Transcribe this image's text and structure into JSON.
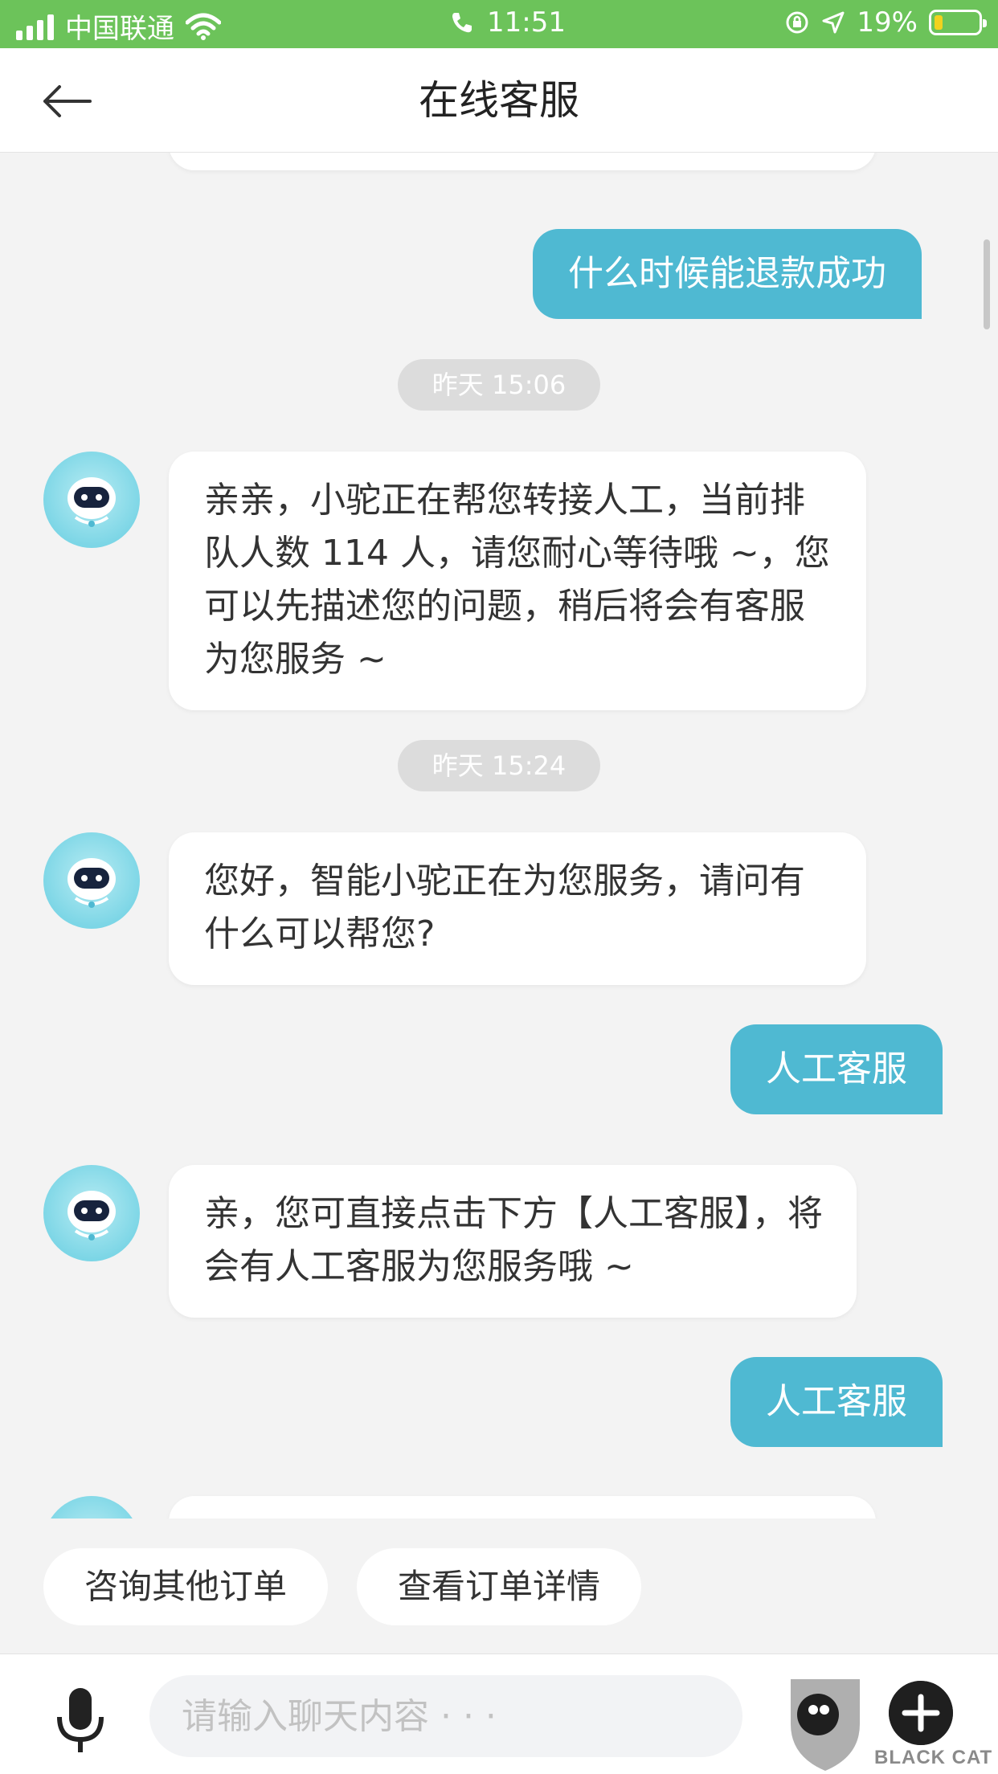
{
  "status_bar": {
    "carrier": "中国联通",
    "time": "11:51",
    "battery": "19%"
  },
  "header": {
    "title": "在线客服"
  },
  "chat": {
    "msg_user_1": "什么时候能退款成功",
    "time_1": "昨天 15:06",
    "msg_bot_1": "亲亲，小驼正在帮您转接人工，当前排队人数 114 人，请您耐心等待哦 ~，您可以先描述您的问题，稍后将会有客服为您服务 ~",
    "time_2": "昨天 15:24",
    "msg_bot_2": "您好，智能小驼正在为您服务，请问有什么可以帮您?",
    "msg_user_2": "人工客服",
    "msg_bot_3": "亲，您可直接点击下方【人工客服】，将会有人工客服为您服务哦 ~",
    "msg_user_3": "人工客服"
  },
  "quick_actions": {
    "consult_other": "咨询其他订单",
    "view_order": "查看订单详情"
  },
  "input": {
    "placeholder": "请输入聊天内容 · · ·"
  },
  "watermark": {
    "text": "BLACK CAT"
  },
  "colors": {
    "status_bar": "#6cc35a",
    "user_bubble": "#4fb9d2",
    "bot_bubble": "#ffffff",
    "background": "#f3f3f3"
  },
  "icons": [
    "signal-icon",
    "wifi-icon",
    "phone-icon",
    "rotation-lock-icon",
    "location-icon",
    "battery-icon",
    "back-arrow-icon",
    "robot-avatar-icon",
    "microphone-icon",
    "plus-icon"
  ]
}
